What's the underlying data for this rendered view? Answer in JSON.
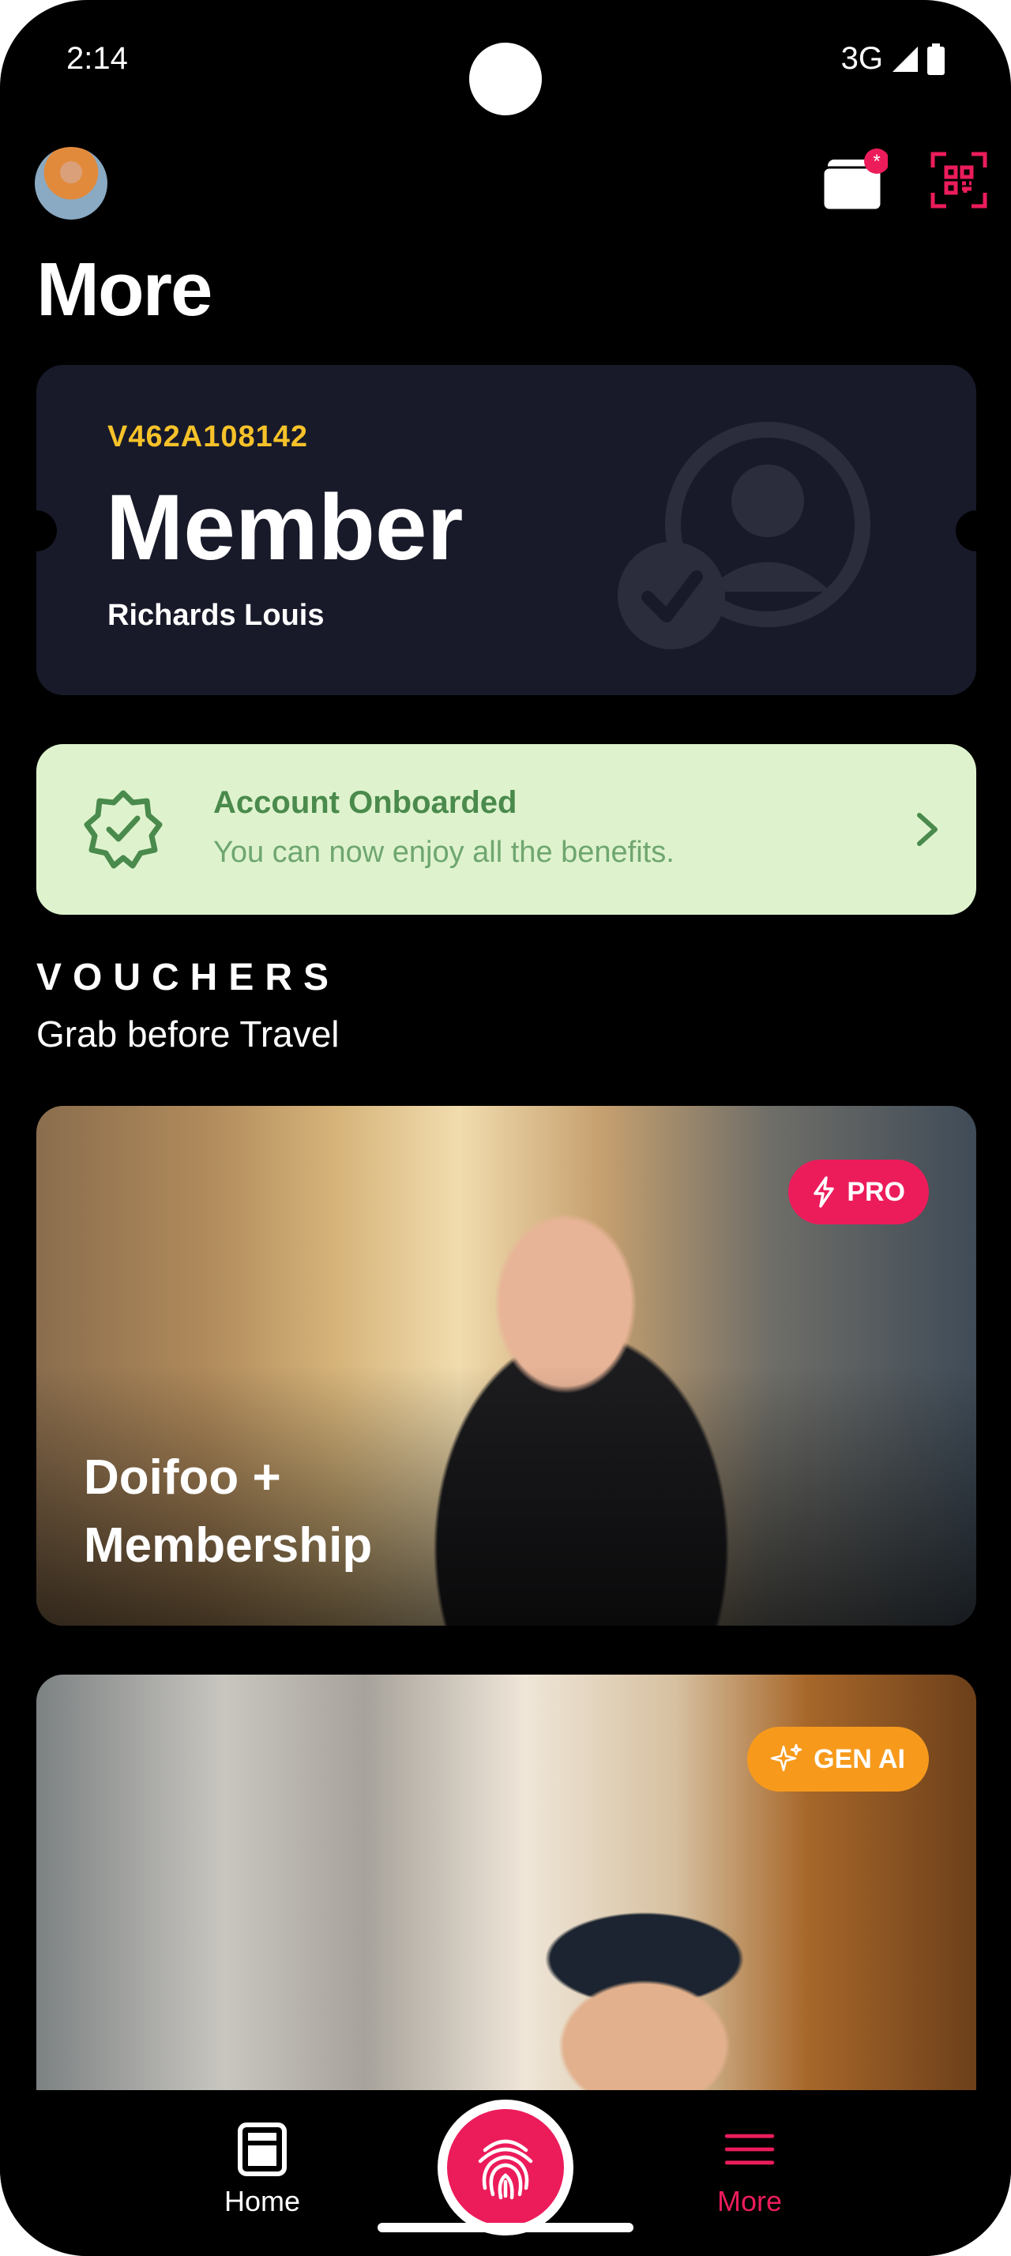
{
  "status_bar": {
    "time": "2:14",
    "network": "3G"
  },
  "header": {
    "title": "More",
    "avatar_icon": "avatar-photo",
    "wallet_icon": "wallet-icon",
    "wallet_badge": "*",
    "qr_icon": "qr-scan-icon"
  },
  "member_card": {
    "id": "V462A108142",
    "tier": "Member",
    "name": "Richards Louis",
    "icon": "verified-user-icon"
  },
  "onboard_banner": {
    "title": "Account Onboarded",
    "subtitle": "You can now enjoy all the benefits.",
    "icon": "verified-badge-icon"
  },
  "vouchers": {
    "label": "VOUCHERS",
    "subtitle": "Grab before Travel",
    "items": [
      {
        "caption_line1": "Doifoo +",
        "caption_line2": "Membership",
        "badge": "PRO",
        "badge_icon": "lightning-icon",
        "badge_color": "#ec1c5b"
      },
      {
        "caption_line1": "",
        "caption_line2": "",
        "badge": "GEN AI",
        "badge_icon": "sparkle-icon",
        "badge_color": "#f79a1c"
      }
    ]
  },
  "tab_bar": {
    "home_label": "Home",
    "more_label": "More",
    "center_icon": "fingerprint-icon"
  },
  "colors": {
    "accent": "#ec1c5b",
    "member_id": "#f6c229",
    "card_bg": "#181a2a",
    "success_bg": "#def3cd",
    "success_text": "#4a8a4c"
  }
}
